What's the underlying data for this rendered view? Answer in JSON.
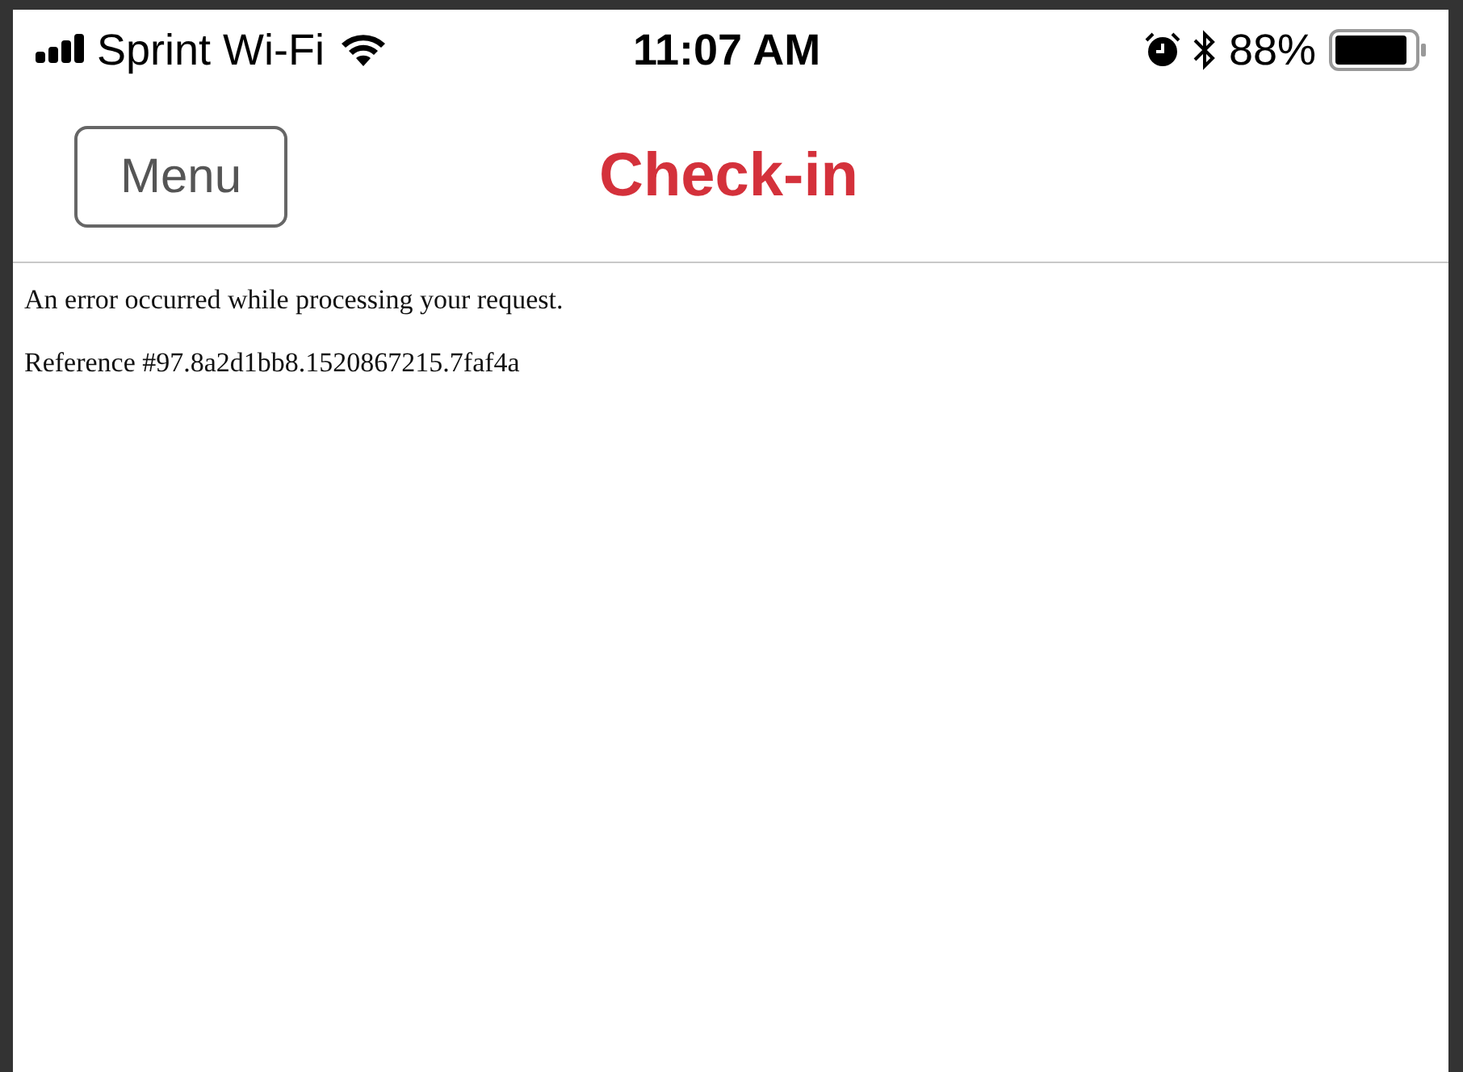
{
  "status_bar": {
    "carrier": "Sprint Wi-Fi",
    "time": "11:07 AM",
    "battery": "88%"
  },
  "header": {
    "menu_button": "Menu",
    "title": "Check-in"
  },
  "messages": [
    "An error occurred while processing your request.",
    "Reference #97.8a2d1bb8.1520867215.7faf4a"
  ]
}
